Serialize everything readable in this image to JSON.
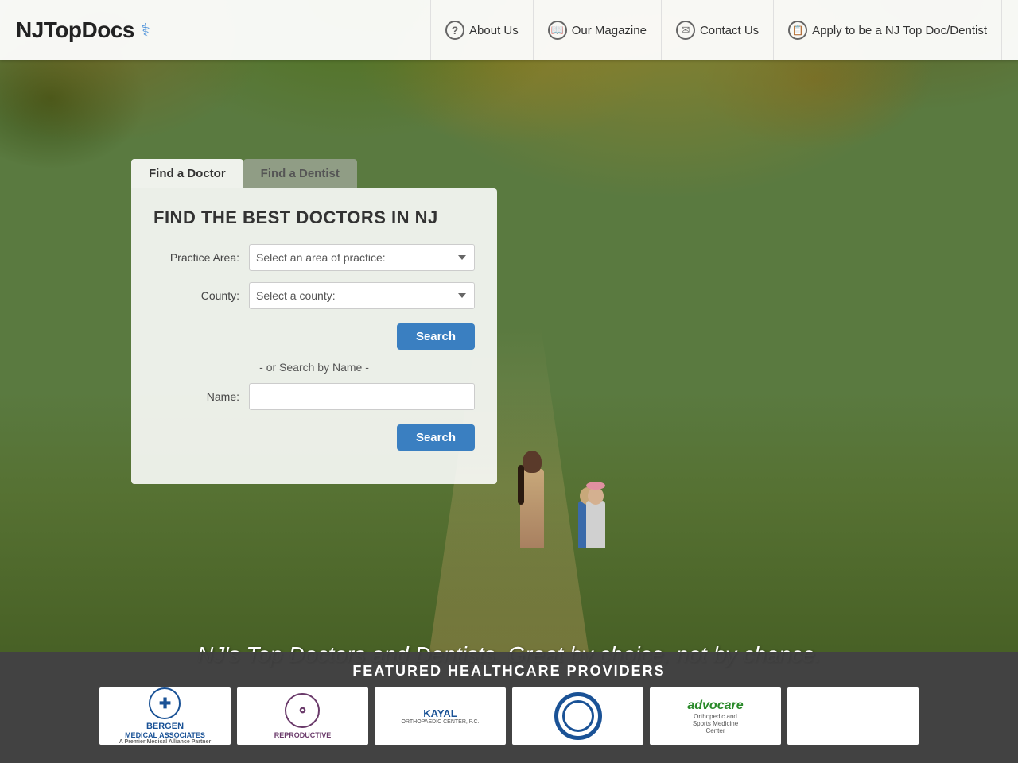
{
  "header": {
    "logo_text": "NJTopDocs",
    "nav": [
      {
        "id": "about-us",
        "label": "About Us",
        "icon": "question"
      },
      {
        "id": "our-magazine",
        "label": "Our Magazine",
        "icon": "book"
      },
      {
        "id": "contact-us",
        "label": "Contact Us",
        "icon": "envelope"
      },
      {
        "id": "apply",
        "label": "Apply to be a NJ Top Doc/Dentist",
        "icon": "document"
      }
    ]
  },
  "tabs": [
    {
      "id": "find-doctor",
      "label": "Find a Doctor",
      "active": true
    },
    {
      "id": "find-dentist",
      "label": "Find a Dentist",
      "active": false
    }
  ],
  "search_form": {
    "title": "FIND THE BEST DOCTORS IN NJ",
    "practice_area_label": "Practice Area:",
    "practice_area_placeholder": "Select an area of practice:",
    "county_label": "County:",
    "county_placeholder": "Select a county:",
    "search_button_1": "Search",
    "or_text": "- or Search by Name -",
    "name_label": "Name:",
    "name_placeholder": "",
    "search_button_2": "Search"
  },
  "hero": {
    "slogan": "NJ's Top Doctors and Dentists. Great by choice, not by chance."
  },
  "featured": {
    "title": "FEATURED HEALTHCARE PROVIDERS",
    "providers": [
      {
        "id": "bergen",
        "name": "BERGEN\nMEDICAL ASSOCIATES",
        "sub": "A Premier Medical Alliance Partner"
      },
      {
        "id": "reproductive",
        "name": "REPRODUCTIVE",
        "sub": ""
      },
      {
        "id": "kayal",
        "name": "KAYAL\nORTHOPAEDIC CENTER, P.C.",
        "sub": ""
      },
      {
        "id": "circle",
        "name": "",
        "sub": ""
      },
      {
        "id": "advocare",
        "name": "advocare\nOrthopedic and\nSports Medicine\nCenter",
        "sub": ""
      },
      {
        "id": "empty",
        "name": "",
        "sub": ""
      }
    ]
  }
}
